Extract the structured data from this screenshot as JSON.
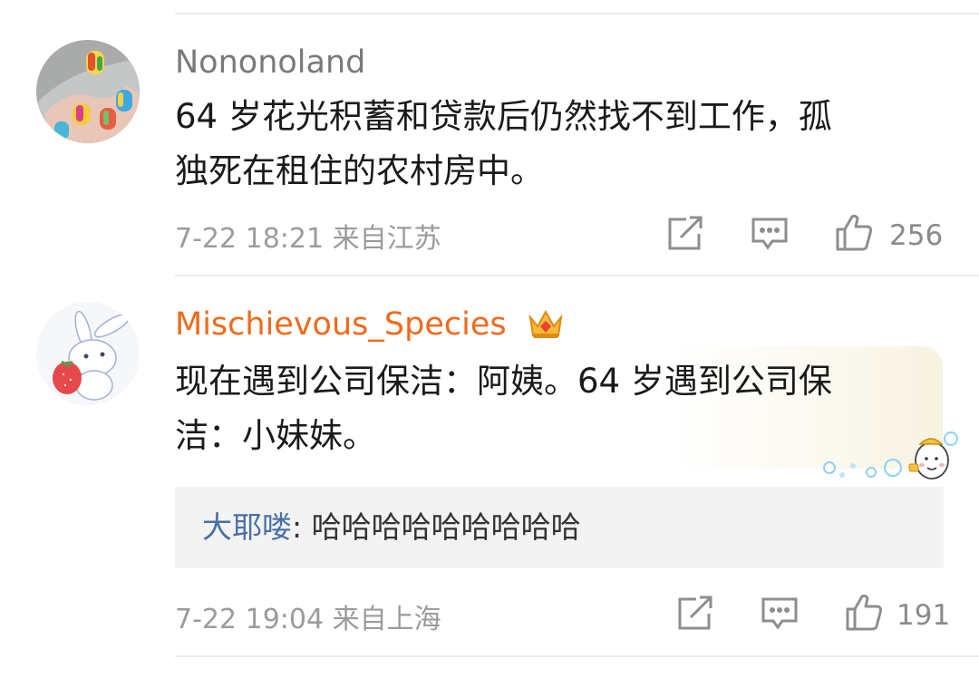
{
  "comments": [
    {
      "username": "Nononoland",
      "text_line1": "64 岁花光积蓄和贷款后仍然找不到工作，孤",
      "text_line2": "独死在租住的农村房中。",
      "time": "7-22 18:21",
      "location": "来自江苏",
      "likes": "256",
      "username_color": "#7a7a7a"
    },
    {
      "username": "Mischievous_Species",
      "text_line1": "现在遇到公司保洁：阿姨。64 岁遇到公司保",
      "text_line2": "洁：小妹妹。",
      "time": "7-22 19:04",
      "location": "来自上海",
      "likes": "191",
      "username_color": "#f06a1a",
      "badge": "crown-icon",
      "reply": {
        "name": "大耶喽",
        "separator": ": ",
        "text": "哈哈哈哈哈哈哈哈哈"
      }
    }
  ],
  "icons": [
    "share-icon",
    "comment-icon",
    "like-icon"
  ]
}
